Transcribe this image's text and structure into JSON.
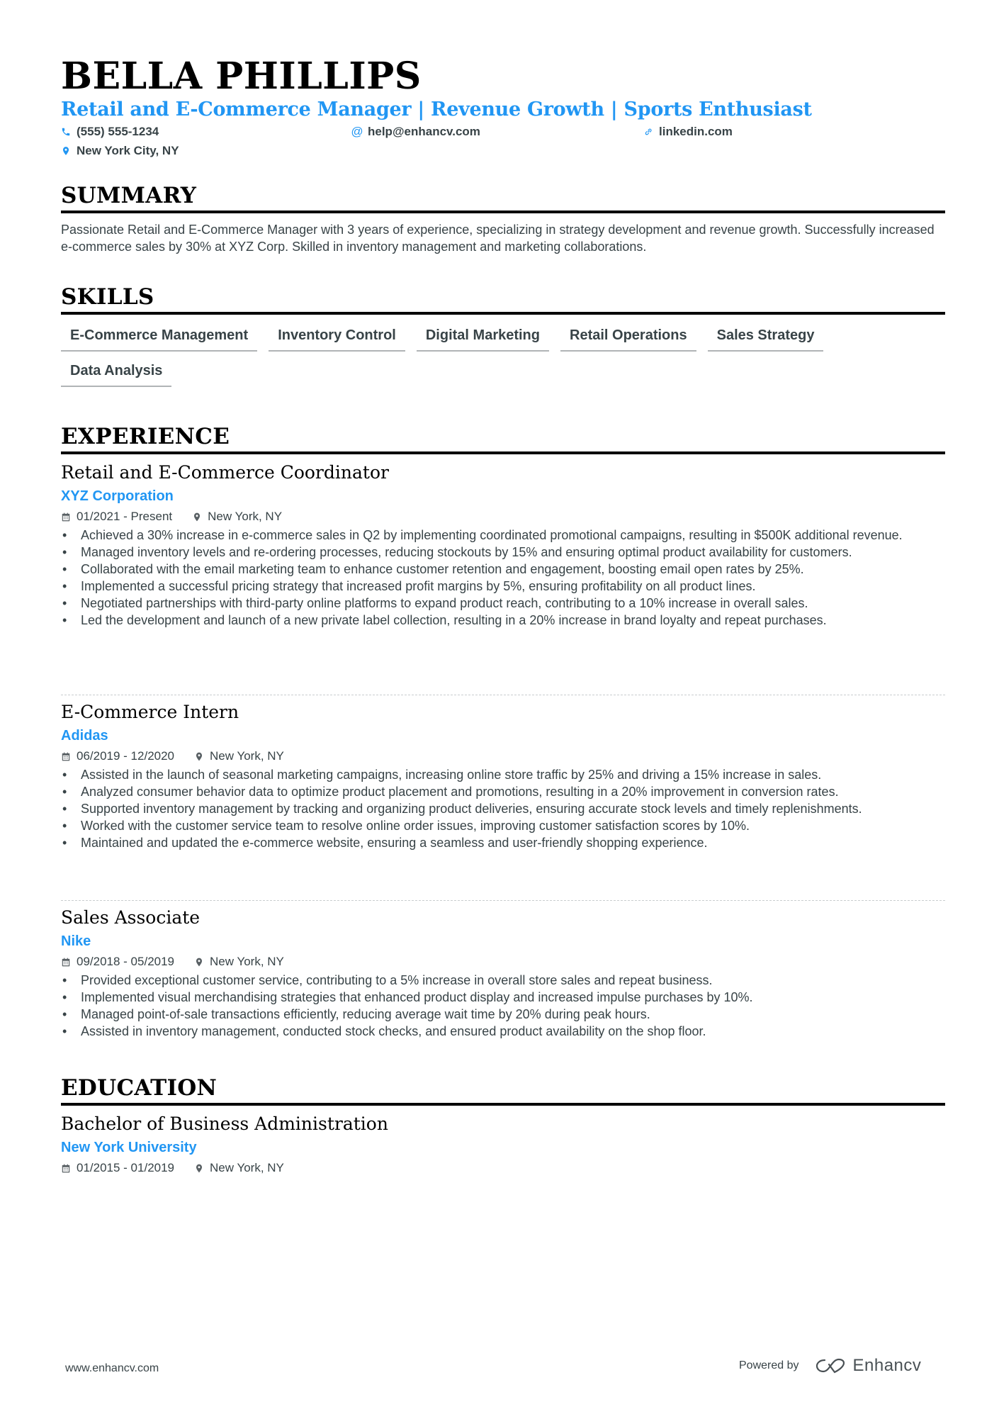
{
  "header": {
    "name": "BELLA PHILLIPS",
    "headline": "Retail and E-Commerce Manager | Revenue Growth | Sports Enthusiast",
    "contacts": {
      "phone": {
        "icon": "phone-icon",
        "value": "(555) 555-1234"
      },
      "email": {
        "icon": "at-icon",
        "value": "help@enhancv.com"
      },
      "linkedin": {
        "icon": "link-icon",
        "value": "linkedin.com"
      },
      "location": {
        "icon": "location-pin-icon",
        "value": "New York City, NY"
      }
    }
  },
  "colors": {
    "accent": "#2196f3",
    "text": "#384347",
    "heading": "#000000"
  },
  "summary": {
    "title": "SUMMARY",
    "text": "Passionate Retail and E-Commerce Manager with 3 years of experience, specializing in strategy development and revenue growth. Successfully increased e-commerce sales by 30% at XYZ Corp. Skilled in inventory management and marketing collaborations."
  },
  "skills": {
    "title": "SKILLS",
    "items": [
      "E-Commerce Management",
      "Inventory Control",
      "Digital Marketing",
      "Retail Operations",
      "Sales Strategy",
      "Data Analysis"
    ]
  },
  "experience": {
    "title": "EXPERIENCE",
    "items": [
      {
        "role": "Retail and E-Commerce Coordinator",
        "company": "XYZ Corporation",
        "dates": "01/2021 - Present",
        "location": "New York, NY",
        "bullets": [
          "Achieved a 30% increase in e-commerce sales in Q2 by implementing coordinated promotional campaigns, resulting in $500K additional revenue.",
          "Managed inventory levels and re-ordering processes, reducing stockouts by 15% and ensuring optimal product availability for customers.",
          "Collaborated with the email marketing team to enhance customer retention and engagement, boosting email open rates by 25%.",
          "Implemented a successful pricing strategy that increased profit margins by 5%, ensuring profitability on all product lines.",
          "Negotiated partnerships with third-party online platforms to expand product reach, contributing to a 10% increase in overall sales.",
          "Led the development and launch of a new private label collection, resulting in a 20% increase in brand loyalty and repeat purchases."
        ]
      },
      {
        "role": "E-Commerce Intern",
        "company": "Adidas",
        "dates": "06/2019 - 12/2020",
        "location": "New York, NY",
        "bullets": [
          "Assisted in the launch of seasonal marketing campaigns, increasing online store traffic by 25% and driving a 15% increase in sales.",
          "Analyzed consumer behavior data to optimize product placement and promotions, resulting in a 20% improvement in conversion rates.",
          "Supported inventory management by tracking and organizing product deliveries, ensuring accurate stock levels and timely replenishments.",
          "Worked with the customer service team to resolve online order issues, improving customer satisfaction scores by 10%.",
          "Maintained and updated the e-commerce website, ensuring a seamless and user-friendly shopping experience."
        ]
      },
      {
        "role": "Sales Associate",
        "company": "Nike",
        "dates": "09/2018 - 05/2019",
        "location": "New York, NY",
        "bullets": [
          "Provided exceptional customer service, contributing to a 5% increase in overall store sales and repeat business.",
          "Implemented visual merchandising strategies that enhanced product display and increased impulse purchases by 10%.",
          "Managed point-of-sale transactions efficiently, reducing average wait time by 20% during peak hours.",
          "Assisted in inventory management, conducted stock checks, and ensured product availability on the shop floor."
        ]
      }
    ]
  },
  "education": {
    "title": "EDUCATION",
    "items": [
      {
        "degree": "Bachelor of Business Administration",
        "school": "New York University",
        "dates": "01/2015 - 01/2019",
        "location": "New York, NY"
      }
    ]
  },
  "footer": {
    "website": "www.enhancv.com",
    "powered_by": "Powered by",
    "brand": "Enhancv"
  }
}
